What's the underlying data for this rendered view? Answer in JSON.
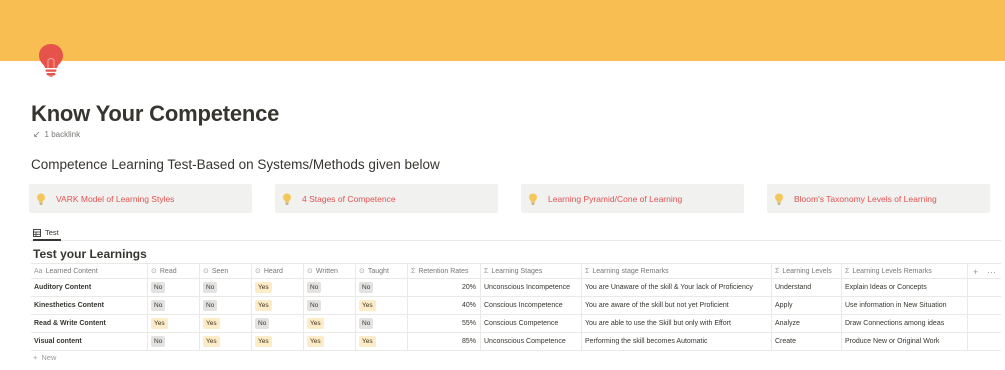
{
  "page": {
    "icon": "lightbulb-icon",
    "title": "Know Your Competence",
    "backlink": "1 backlink",
    "heading": "Competence Learning Test-Based on Systems/Methods given below",
    "colors": {
      "cover": "#f9be52",
      "link": "#df5452",
      "tag_no": "#e3e2e0",
      "tag_yes": "#fdecc8"
    }
  },
  "callouts": [
    {
      "icon": "lightbulb-icon",
      "label": "VARK Model of Learning Styles"
    },
    {
      "icon": "lightbulb-icon",
      "label": "4 Stages of Competence"
    },
    {
      "icon": "lightbulb-icon",
      "label": "Learning Pyramid/Cone of Learning"
    },
    {
      "icon": "lightbulb-icon",
      "label": "Bloom's Taxonomy Levels of Learning"
    }
  ],
  "view": {
    "tab_label": "Test",
    "tab_icon": "table-icon"
  },
  "database": {
    "title": "Test your Learnings",
    "columns": [
      {
        "label": "Learned Content",
        "icon": "title-icon"
      },
      {
        "label": "Read",
        "icon": "select-icon"
      },
      {
        "label": "Seen",
        "icon": "select-icon"
      },
      {
        "label": "Heard",
        "icon": "select-icon"
      },
      {
        "label": "Written",
        "icon": "select-icon"
      },
      {
        "label": "Taught",
        "icon": "select-icon"
      },
      {
        "label": "Retention Rates",
        "icon": "formula-icon"
      },
      {
        "label": "Learning Stages",
        "icon": "formula-icon"
      },
      {
        "label": "Learning stage Remarks",
        "icon": "formula-icon"
      },
      {
        "label": "Learning Levels",
        "icon": "formula-icon"
      },
      {
        "label": "Learning Levels Remarks",
        "icon": "formula-icon"
      }
    ],
    "rows": [
      {
        "content": "Auditory Content",
        "read": "No",
        "seen": "No",
        "heard": "Yes",
        "written": "No",
        "taught": "No",
        "retention": "20%",
        "stage": "Unconscious Incompetence",
        "stage_remark": "You are Unaware of the skill & Your lack of Proficiency",
        "level": "Understand",
        "level_remark": "Explain Ideas or Concepts"
      },
      {
        "content": "Kinesthetics Content",
        "read": "No",
        "seen": "No",
        "heard": "Yes",
        "written": "No",
        "taught": "Yes",
        "retention": "40%",
        "stage": "Conscious Incompetence",
        "stage_remark": "You are aware of the skill but not yet Proficient",
        "level": "Apply",
        "level_remark": "Use information in New Situation"
      },
      {
        "content": "Read & Write Content",
        "read": "Yes",
        "seen": "Yes",
        "heard": "No",
        "written": "Yes",
        "taught": "No",
        "retention": "55%",
        "stage": "Conscious Competence",
        "stage_remark": "You are able to use the Skill but only with Effort",
        "level": "Analyze",
        "level_remark": "Draw Connections among ideas"
      },
      {
        "content": "Visual content",
        "read": "No",
        "seen": "Yes",
        "heard": "Yes",
        "written": "Yes",
        "taught": "Yes",
        "retention": "85%",
        "stage": "Unconscious Competence",
        "stage_remark": "Performing the skill becomes Automatic",
        "level": "Create",
        "level_remark": "Produce New or Original Work"
      }
    ],
    "add_property": "+",
    "more_options": "···",
    "new_label": "New",
    "new_icon": "plus-icon"
  }
}
